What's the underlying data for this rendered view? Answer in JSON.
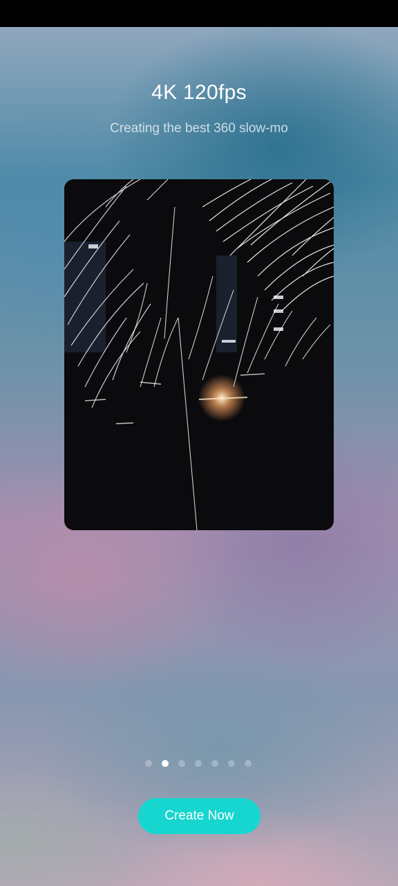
{
  "onboarding": {
    "title": "4K 120fps",
    "subtitle": "Creating the best 360 slow-mo",
    "preview_image": "sparks-slow-motion-video",
    "pager": {
      "total_pages": 7,
      "current_page": 2
    },
    "cta_label": "Create Now",
    "accent_color": "#17d6cf"
  }
}
